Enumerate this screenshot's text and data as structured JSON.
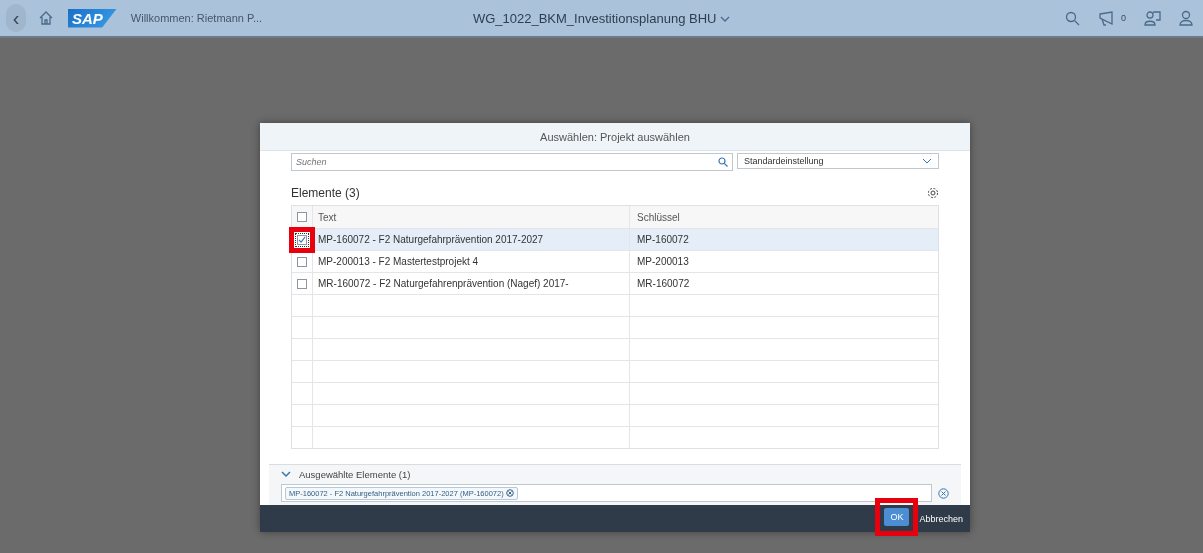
{
  "shell": {
    "back": "‹",
    "logo": "SAP",
    "welcome": "Willkommen: Rietmann P...",
    "title": "WG_1022_BKM_Investitionsplanung BHU",
    "notification_count": "0"
  },
  "dialog": {
    "title": "Auswählen: Projekt auswählen",
    "search": {
      "placeholder": "Suchen"
    },
    "variant": "Standardeinstellung",
    "list_title": "Elemente (3)",
    "columns": [
      "Text",
      "Schlüssel"
    ],
    "select_all": {
      "checked": false
    },
    "rows": [
      {
        "text": "MP-160072 - F2 Naturgefahrprävention 2017-2027",
        "key": "MP-160072",
        "selected": true,
        "highlighted": true
      },
      {
        "text": "MP-200013 - F2 Mastertestprojekt 4",
        "key": "MP-200013",
        "selected": false,
        "highlighted": false
      },
      {
        "text": "MR-160072 - F2 Naturgefahrenprävention (Nagef) 2017-",
        "key": "MR-160072",
        "selected": false,
        "highlighted": false
      }
    ],
    "selected_panel": {
      "title": "Ausgewählte Elemente (1)",
      "expanded": true,
      "tokens": [
        "MP-160072 - F2 Naturgefahrprävention 2017-2027 (MP-160072)"
      ]
    },
    "buttons": [
      {
        "label": "OK",
        "kind": "primary",
        "highlighted": true
      },
      {
        "label": "Abbrechen",
        "kind": "plain",
        "highlighted": false
      }
    ]
  }
}
